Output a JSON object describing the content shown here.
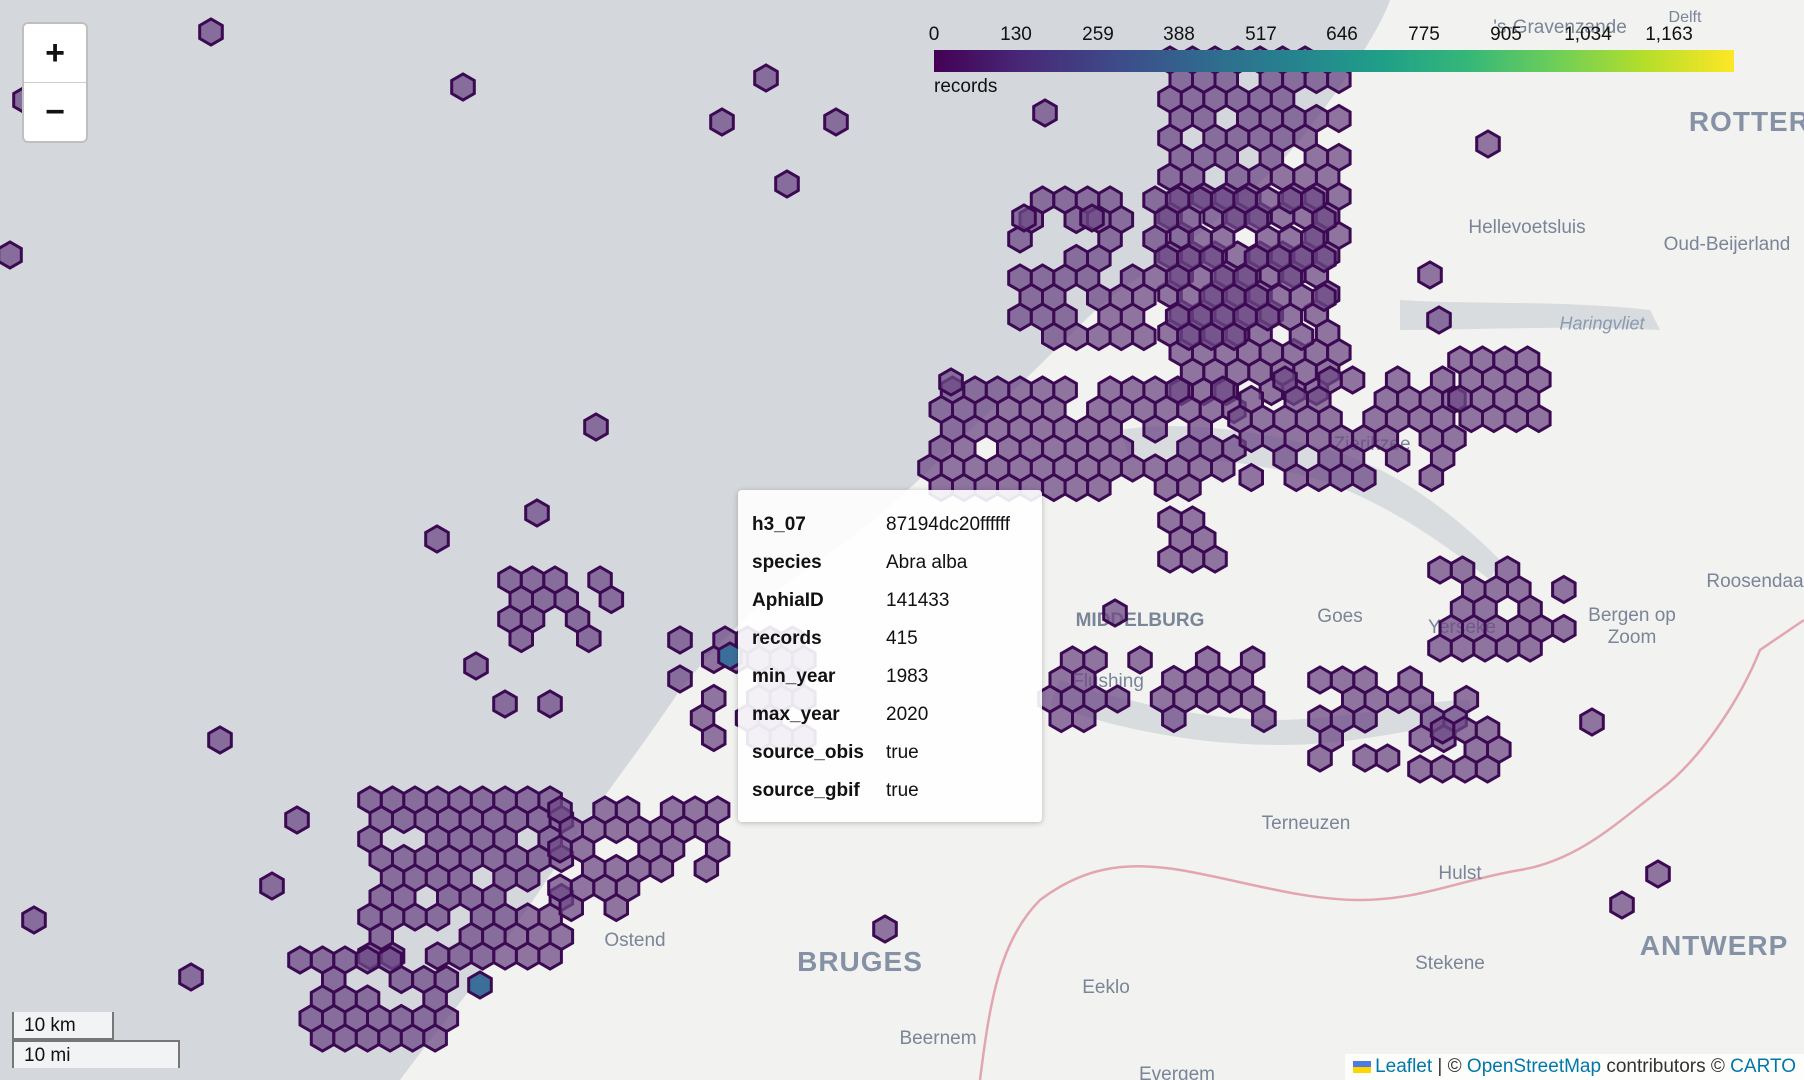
{
  "map": {
    "zoom_in_label": "+",
    "zoom_out_label": "−",
    "legend": {
      "ticks": [
        "0",
        "130",
        "259",
        "388",
        "517",
        "646",
        "775",
        "905",
        "1,034",
        "1,163"
      ],
      "title": "records",
      "min": 0,
      "max": 1163,
      "colormap": [
        "#440154",
        "#482878",
        "#3e4989",
        "#31688e",
        "#26828e",
        "#1f9e89",
        "#35b779",
        "#6ece58",
        "#b5de2b",
        "#fde725"
      ]
    },
    "places": {
      "delft": "Delft",
      "rotterdam": "ROTTERD",
      "hellevoetsluis": "Hellevoetsluis",
      "oud_beijerland": "Oud-Beijerland",
      "haringvliet": "Haringvliet",
      "zierikzee": "Zierikzee",
      "roosendaal": "Roosendaa",
      "bergen_op_zoom": "Bergen op\nZoom",
      "middelburg": "MIDDELBURG",
      "goes": "Goes",
      "yerseke": "Yerseke",
      "vlissingen": "Flushing",
      "terneuzen": "Terneuzen",
      "hulst": "Hulst",
      "antwerp": "ANTWERP",
      "stekene": "Stekene",
      "bruges": "BRUGES",
      "eeklo": "Eeklo",
      "beernem": "Beernem",
      "evergem": "Evergem",
      "ostend": "Ostend",
      "zandvoort": "'s-Gravenzande"
    },
    "tooltip": {
      "rows": [
        {
          "key": "h3_07",
          "value": "87194dc20ffffff"
        },
        {
          "key": "species",
          "value": "Abra alba"
        },
        {
          "key": "AphiaID",
          "value": "141433"
        },
        {
          "key": "records",
          "value": "415"
        },
        {
          "key": "min_year",
          "value": "1983"
        },
        {
          "key": "max_year",
          "value": "2020"
        },
        {
          "key": "source_obis",
          "value": "true"
        },
        {
          "key": "source_gbif",
          "value": "true"
        }
      ]
    },
    "scale": {
      "km": "10 km",
      "mi": "10 mi"
    },
    "attribution": {
      "leaflet": "Leaflet",
      "sep": " | © ",
      "osm": "OpenStreetMap",
      "contributors": " contributors © ",
      "carto": "CARTO"
    },
    "colors": {
      "sea": "#d4d8dc",
      "land": "#f2f2f0",
      "hex_stroke": "#3b0a52",
      "hex_fill": "#6e4a86",
      "border": "#e3a6b0"
    }
  }
}
